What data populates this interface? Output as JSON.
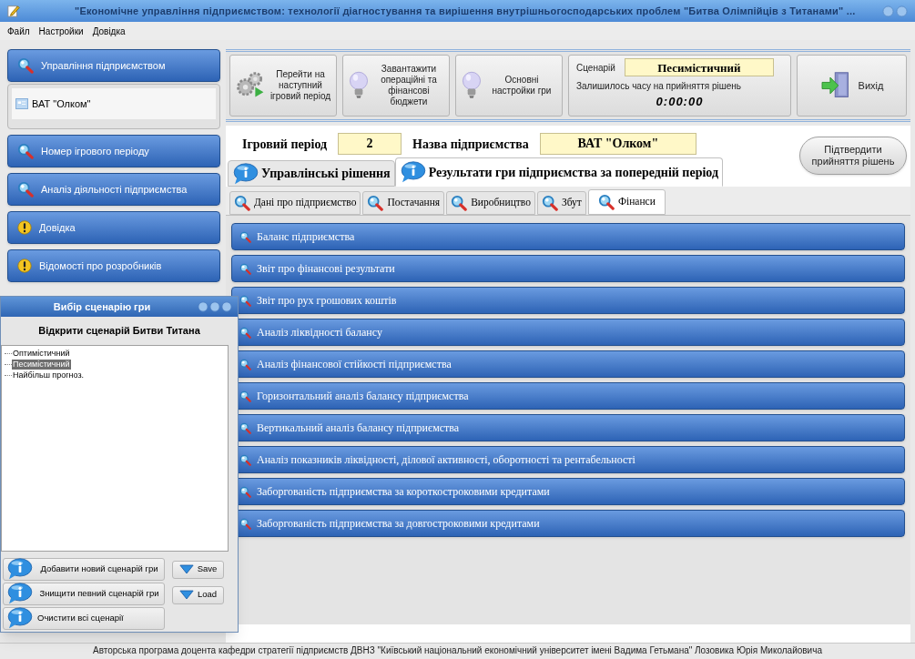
{
  "window": {
    "title": "\"Економічне управління підприємством: технології діагностування та вирішення внутрішньогосподарських проблем \"Битва Олімпійців з Титанами\" ..."
  },
  "menu": [
    "Файл",
    "Настройки",
    "Довідка"
  ],
  "sidebar": {
    "items": [
      {
        "kind": "search",
        "label": "Управління підприємством"
      },
      {
        "kind": "company",
        "label": "ВАТ \"Олком\""
      },
      {
        "kind": "search",
        "label": "Номер ігрового періоду"
      },
      {
        "kind": "search",
        "label": "Аналіз діяльності підприємства"
      },
      {
        "kind": "alert",
        "label": "Довідка"
      },
      {
        "kind": "alert",
        "label": "Відомості про розробників"
      }
    ]
  },
  "toolbar": {
    "buttons": [
      {
        "kind": "gears",
        "label": "Перейти на наступний ігровий період"
      },
      {
        "kind": "bulb",
        "label": "Завантажити операційні та фінансові бюджети"
      },
      {
        "kind": "bulb",
        "label": "Основні настройки гри"
      }
    ],
    "scenario": {
      "label": "Сценарій",
      "value": "Песимістичний",
      "caption": "Залишилось часу на прийняття рішень",
      "timer": "0:00:00"
    },
    "exit": "Вихід"
  },
  "info": {
    "period_label": "Ігровий період",
    "period": "2",
    "company_label": "Назва підприємства",
    "company": "ВАТ \"Олком\"",
    "confirm": "Підтвердити прийняття рішень"
  },
  "tabs": [
    {
      "label": "Управлінські рішення",
      "selected": false
    },
    {
      "label": "Результати гри підприємства за попередній період",
      "selected": true
    }
  ],
  "subtabs": [
    {
      "label": "Дані про підприємство",
      "selected": false
    },
    {
      "label": "Постачання",
      "selected": false
    },
    {
      "label": "Виробництво",
      "selected": false
    },
    {
      "label": "Збут",
      "selected": false
    },
    {
      "label": "Фінанси",
      "selected": true
    }
  ],
  "reports": [
    "Баланс підприємства",
    "Звіт про фінансові результати",
    "Звіт про рух грошових коштів",
    "Аналіз ліквідності балансу",
    "Аналіз фінансової стійкості підприємства",
    "Горизонтальний аналіз балансу підприємства",
    "Вертикальний аналіз балансу підприємства",
    "Аналіз показників ліквідності, ділової активності, оборотності та рентабельності",
    "Заборгованість підприємства за короткостроковими кредитами",
    "Заборгованість підприємства за довгостроковими кредитами"
  ],
  "dialog": {
    "title": "Вибір сценарію гри",
    "heading": "Відкрити сценарій Битви Титана",
    "tree": [
      {
        "label": "Оптимістичний",
        "selected": false
      },
      {
        "label": "Песимістичний",
        "selected": true
      },
      {
        "label": "Найбільш прогноз.",
        "selected": false
      }
    ],
    "actions": [
      "Добавити новий сценарій гри",
      "Знищити певний сценарій гри",
      "Очистити всі сценарії"
    ],
    "side_buttons": [
      "Save",
      "Load"
    ]
  },
  "footer": "Авторська програма доцента кафедри стратегії підприємств ДВНЗ \"Київський національний економічний університет імені Вадима Гетьмана\" Лозовика Юрія Миколайовича"
}
